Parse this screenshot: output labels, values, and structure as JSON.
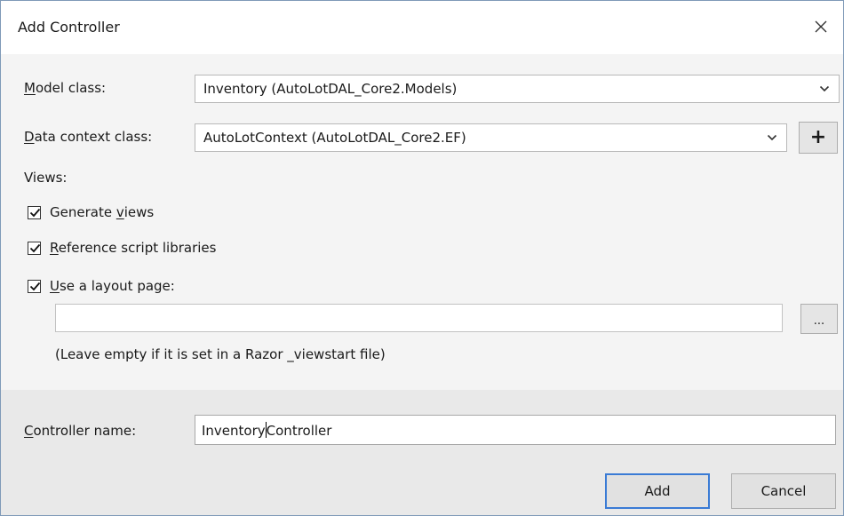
{
  "dialog": {
    "title": "Add Controller",
    "close_icon": "close-icon"
  },
  "model_class": {
    "label_prefix": "",
    "label_accel": "M",
    "label_rest": "odel class:",
    "value": "Inventory (AutoLotDAL_Core2.Models)",
    "icon": "chevron-down-icon"
  },
  "data_context": {
    "label_accel": "D",
    "label_rest": "ata context class:",
    "value": "AutoLotContext (AutoLotDAL_Core2.EF)",
    "icon": "chevron-down-icon",
    "add_label": "+"
  },
  "views": {
    "label": "Views:",
    "generate": {
      "pre": "Generate ",
      "accel": "v",
      "post": "iews",
      "checked": true
    },
    "reference": {
      "pre": "",
      "accel": "R",
      "post": "eference script libraries",
      "checked": true
    },
    "layout": {
      "pre": "",
      "accel": "U",
      "post": "se a layout page:",
      "checked": true
    },
    "layout_path_value": "",
    "browse_label": "...",
    "hint": "(Leave empty if it is set in a Razor _viewstart file)"
  },
  "controller": {
    "label_accel": "C",
    "label_rest": "ontroller name:",
    "value_before_caret": "Inventory",
    "value_after_caret": "Controller"
  },
  "buttons": {
    "add_label": "Add",
    "cancel_label": "Cancel"
  }
}
